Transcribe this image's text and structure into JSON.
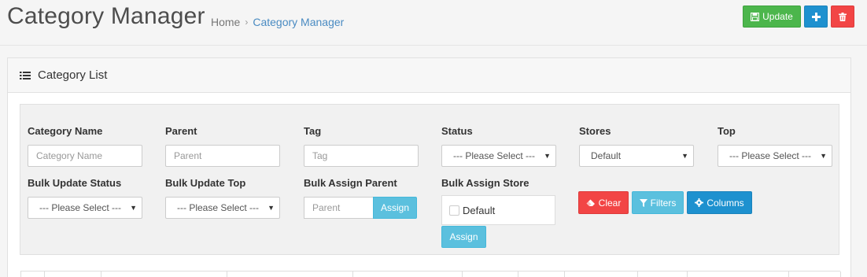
{
  "header": {
    "title": "Category Manager",
    "breadcrumb": {
      "home": "Home",
      "separator": "›",
      "current": "Category Manager"
    },
    "buttons": {
      "update": "Update"
    }
  },
  "panel": {
    "title": "Category List"
  },
  "filters": {
    "category_name": {
      "label": "Category Name",
      "placeholder": "Category Name"
    },
    "parent": {
      "label": "Parent",
      "placeholder": "Parent"
    },
    "tag": {
      "label": "Tag",
      "placeholder": "Tag"
    },
    "status": {
      "label": "Status",
      "value": "--- Please Select ---"
    },
    "stores": {
      "label": "Stores",
      "value": "Default"
    },
    "top": {
      "label": "Top",
      "value": "--- Please Select ---"
    },
    "bulk_update_status": {
      "label": "Bulk Update Status",
      "value": "--- Please Select ---"
    },
    "bulk_update_top": {
      "label": "Bulk Update Top",
      "value": "--- Please Select ---"
    },
    "bulk_assign_parent": {
      "label": "Bulk Assign Parent",
      "placeholder": "Parent",
      "button": "Assign"
    },
    "bulk_assign_store": {
      "label": "Bulk Assign Store",
      "option": "Default",
      "button": "Assign"
    }
  },
  "actions": {
    "clear": "Clear",
    "filters": "Filters",
    "columns": "Columns"
  },
  "colors": {
    "green": "#4cb64c",
    "blue": "#1e91cf",
    "red": "#f24545",
    "info": "#5bc0de",
    "link": "#4a8bc2"
  }
}
